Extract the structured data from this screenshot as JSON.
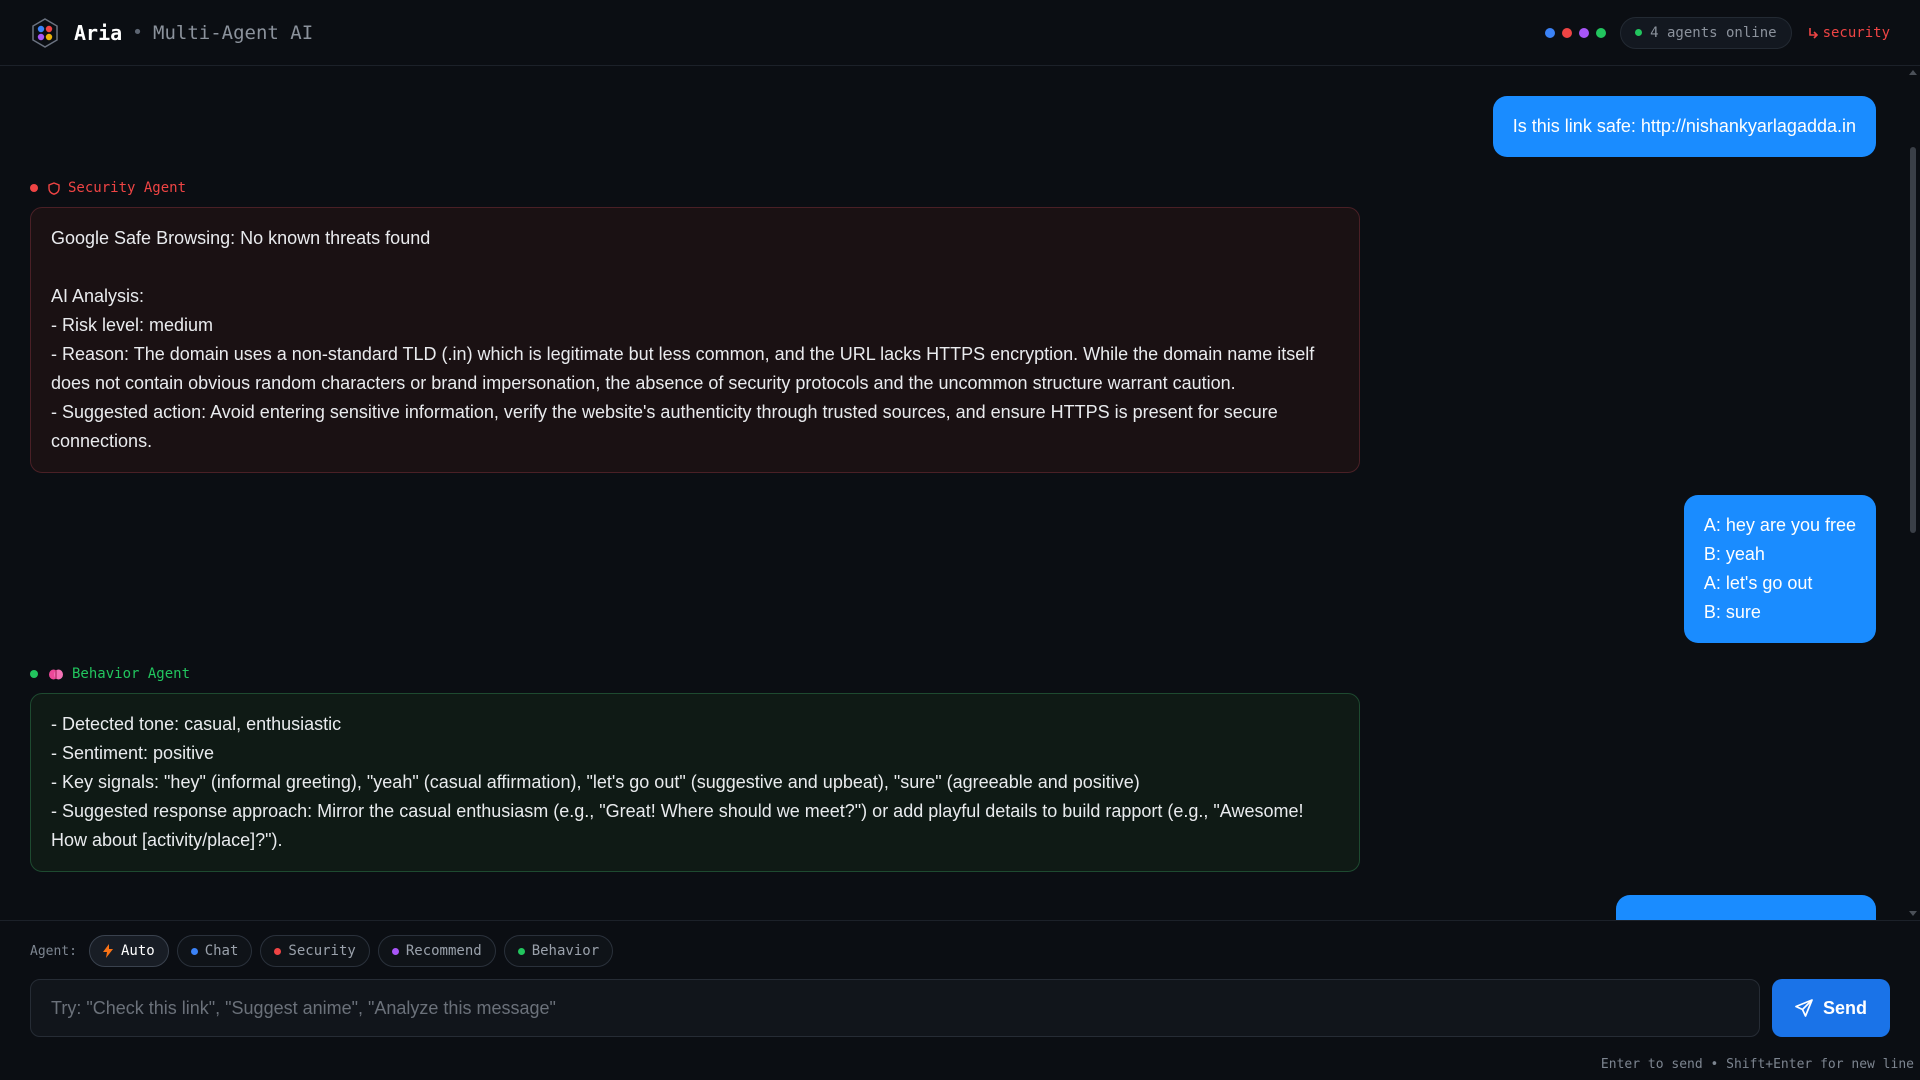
{
  "header": {
    "app_name": "Aria",
    "separator": "•",
    "subtitle": "Multi-Agent AI",
    "status_dots": [
      "#3b82f6",
      "#ef4444",
      "#a855f7",
      "#22c55e"
    ],
    "online_text": "4 agents online",
    "route_text": "security",
    "route_color": "#ef4444"
  },
  "messages": {
    "user1": "Is this link safe: http://nishankyarlagadda.in",
    "security_label": "Security Agent",
    "security_color": "#ef4444",
    "security_text": "Google Safe Browsing: No known threats found\n\nAI Analysis:\n- Risk level: medium\n- Reason: The domain uses a non-standard TLD (.in) which is legitimate but less common, and the URL lacks HTTPS encryption. While the domain name itself does not contain obvious random characters or brand impersonation, the absence of security protocols and the uncommon structure warrant caution.\n- Suggested action: Avoid entering sensitive information, verify the website's authenticity through trusted sources, and ensure HTTPS is present for secure connections.",
    "user2": "A: hey are you free\nB: yeah\nA: let's go out\nB: sure",
    "behavior_label": "Behavior Agent",
    "behavior_color": "#22c55e",
    "behavior_text": "- Detected tone: casual, enthusiastic\n- Sentiment: positive\n- Key signals: \"hey\" (informal greeting), \"yeah\" (casual affirmation), \"let's go out\" (suggestive and upbeat), \"sure\" (agreeable and positive)\n- Suggested response approach: Mirror the casual enthusiasm (e.g., \"Great! Where should we meet?\") or add playful details to build rapport (e.g., \"Awesome! How about [activity/place]?\")."
  },
  "composer": {
    "agent_label": "Agent:",
    "chips": [
      {
        "label": "Auto",
        "color": "#f97316",
        "active": true
      },
      {
        "label": "Chat",
        "color": "#3b82f6",
        "active": false
      },
      {
        "label": "Security",
        "color": "#ef4444",
        "active": false
      },
      {
        "label": "Recommend",
        "color": "#a855f7",
        "active": false
      },
      {
        "label": "Behavior",
        "color": "#22c55e",
        "active": false
      }
    ],
    "placeholder": "Try: \"Check this link\", \"Suggest anime\", \"Analyze this message\"",
    "send_label": "Send",
    "hint": "Enter to send • Shift+Enter for new line"
  },
  "icons": {
    "logo": "hexagon-logo-icon",
    "route": "corner-down-right-icon",
    "security": "shield-icon",
    "behavior": "brain-icon",
    "auto": "lightning-icon",
    "send": "paper-plane-icon"
  }
}
